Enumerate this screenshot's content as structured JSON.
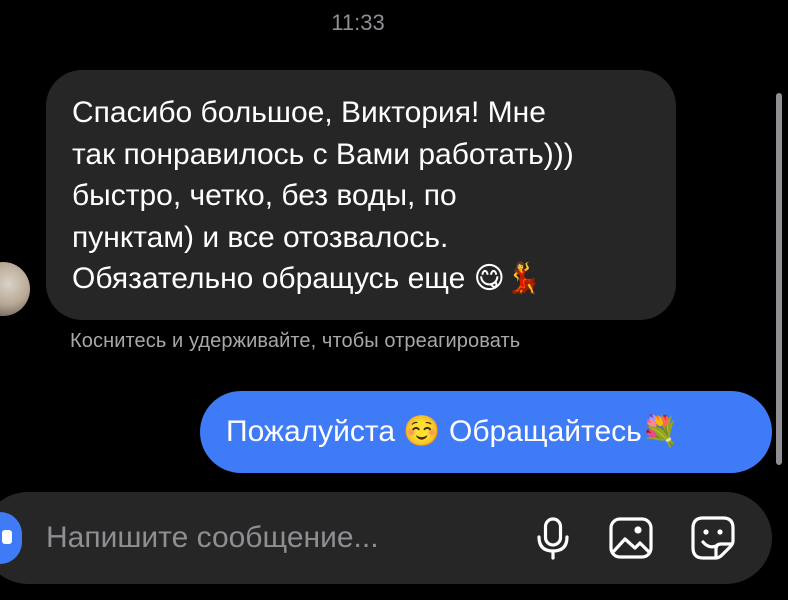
{
  "status": {
    "time": "11:33"
  },
  "messages": [
    {
      "direction": "incoming",
      "text": "Спасибо большое, Виктория! Мне\nтак понравилось с Вами работать)))\nбыстро, четко, без воды, по\nпунктам) и все отозвалось.\nОбязательно обращусь еще 😋💃"
    },
    {
      "direction": "outgoing",
      "text": "Пожалуйста ☺️ Обращайтесь💐"
    }
  ],
  "hint": "Коснитесь и удерживайте, чтобы отреагировать",
  "composer": {
    "placeholder": "Напишите сообщение...",
    "icons": [
      "camera-icon",
      "microphone-icon",
      "gallery-icon",
      "sticker-icon"
    ]
  },
  "colors": {
    "background": "#000000",
    "incoming_bubble": "#262626",
    "outgoing_bubble": "#3f7bf6",
    "secondary_text": "#8e8e93"
  }
}
